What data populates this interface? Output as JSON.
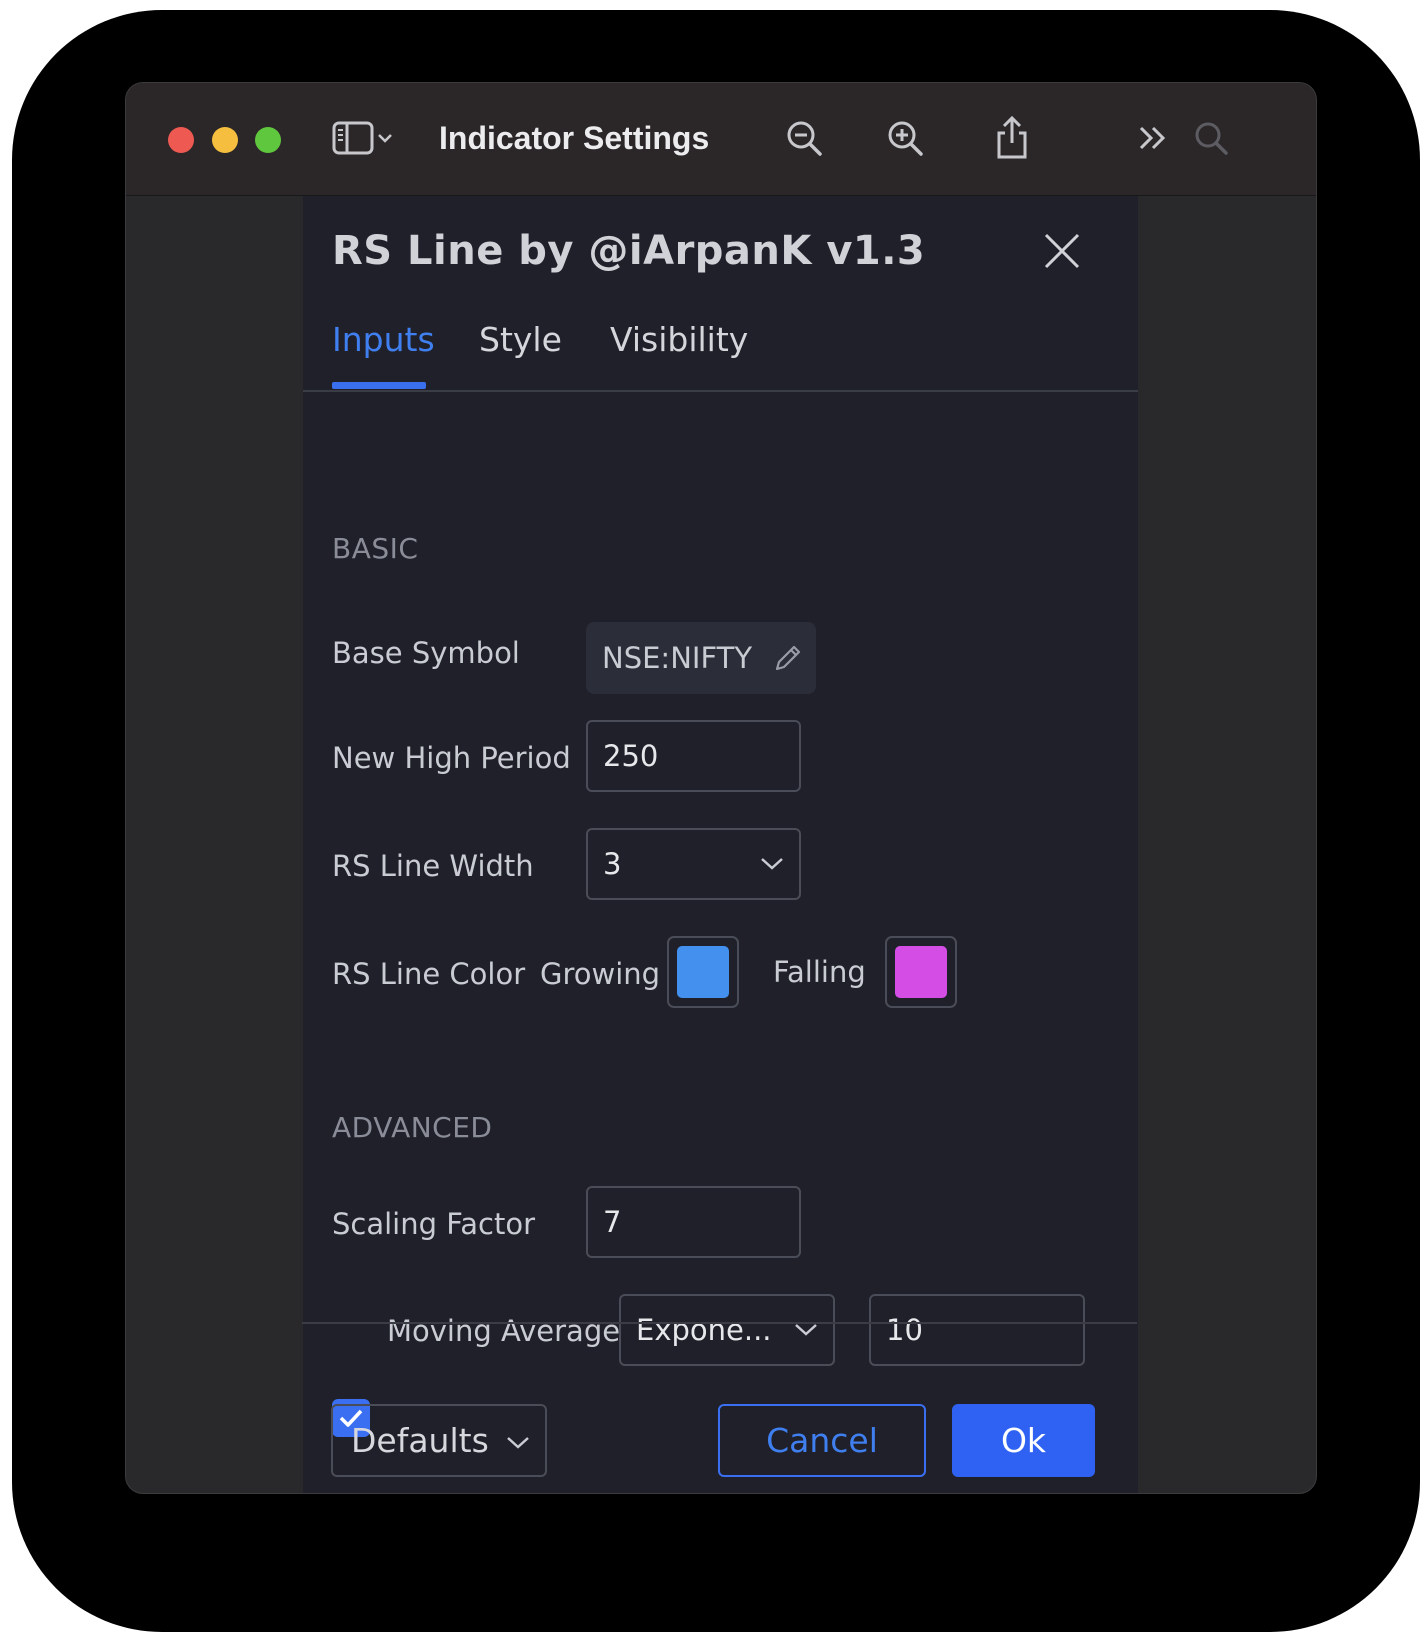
{
  "window": {
    "title": "Indicator Settings"
  },
  "dialog": {
    "title": "RS Line by @iArpanK v1.3",
    "tabs": [
      {
        "label": "Inputs",
        "active": true
      },
      {
        "label": "Style",
        "active": false
      },
      {
        "label": "Visibility",
        "active": false
      }
    ],
    "basic": {
      "section_label": "BASIC",
      "base_symbol": {
        "label": "Base Symbol",
        "value": "NSE:NIFTY"
      },
      "new_high_period": {
        "label": "New High Period",
        "value": "250"
      },
      "rs_line_width": {
        "label": "RS Line Width",
        "value": "3"
      },
      "rs_line_color": {
        "label": "RS Line Color",
        "growing_label": "Growing",
        "growing_color": "#4490ee",
        "falling_label": "Falling",
        "falling_color": "#d44ee6"
      }
    },
    "advanced": {
      "section_label": "ADVANCED",
      "scaling_factor": {
        "label": "Scaling Factor",
        "value": "7"
      },
      "moving_average": {
        "label": "Moving Average",
        "checked": true,
        "type_value": "Expone...",
        "length_value": "10"
      }
    },
    "footer": {
      "defaults_label": "Defaults",
      "cancel_label": "Cancel",
      "ok_label": "Ok"
    }
  },
  "colors": {
    "accent": "#3b6ff2",
    "dialog_bg": "#1f2029",
    "window_bg": "#29292b"
  },
  "icons": [
    "sidebar-icon",
    "chevron-down-icon",
    "zoom-out-icon",
    "zoom-in-icon",
    "share-icon",
    "double-chevron-right-icon",
    "search-icon",
    "close-icon",
    "pencil-icon",
    "checkmark-icon"
  ]
}
